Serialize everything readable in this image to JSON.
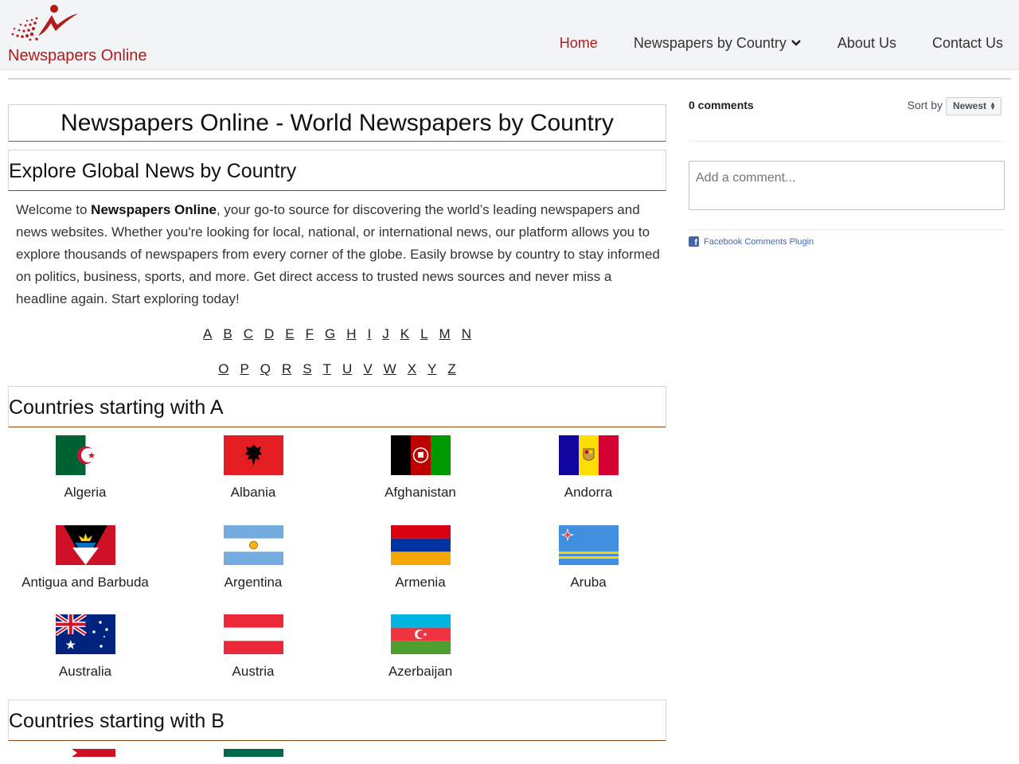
{
  "header": {
    "logo_text": "Newspapers Online",
    "nav": [
      {
        "label": "Home",
        "active": true
      },
      {
        "label": "Newspapers by Country",
        "dropdown": true
      },
      {
        "label": "About Us"
      },
      {
        "label": "Contact Us"
      }
    ]
  },
  "main": {
    "page_title": "Newspapers Online - World Newspapers by Country",
    "explore_heading": "Explore Global News by Country",
    "intro_before": "Welcome to ",
    "intro_brand": "Newspapers Online",
    "intro_after": ", your go-to source for discovering the world’s leading newspapers and news websites. Whether you're looking for local, national, or international news, our platform allows you to explore thousands of newspapers from every corner of the globe. Easily browse by country to stay informed on politics, business, sports, and more. Get direct access to trusted news sources and never miss a headline again. Start exploring today!",
    "alphabet_row1": [
      "A",
      "B",
      "C",
      "D",
      "E",
      "F",
      "G",
      "H",
      "I",
      "J",
      "K",
      "L",
      "M",
      "N"
    ],
    "alphabet_row2": [
      "O",
      "P",
      "Q",
      "R",
      "S",
      "T",
      "U",
      "V",
      "W",
      "X",
      "Y",
      "Z"
    ],
    "section_a_heading": "Countries starting with A",
    "countries_a": [
      "Algeria",
      "Albania",
      "Afghanistan",
      "Andorra",
      "Antigua and Barbuda",
      "Argentina",
      "Armenia",
      "Aruba",
      "Australia",
      "Austria",
      "Azerbaijan"
    ],
    "section_b_heading": "Countries starting with B"
  },
  "comments": {
    "count_label": "0 comments",
    "sort_label": "Sort by",
    "sort_value": "Newest",
    "input_placeholder": "Add a comment...",
    "plugin_label": "Facebook Comments Plugin"
  },
  "colors": {
    "brand": "#b01c1c",
    "heading_rule": "#8b4513",
    "facebook": "#4267b2"
  }
}
